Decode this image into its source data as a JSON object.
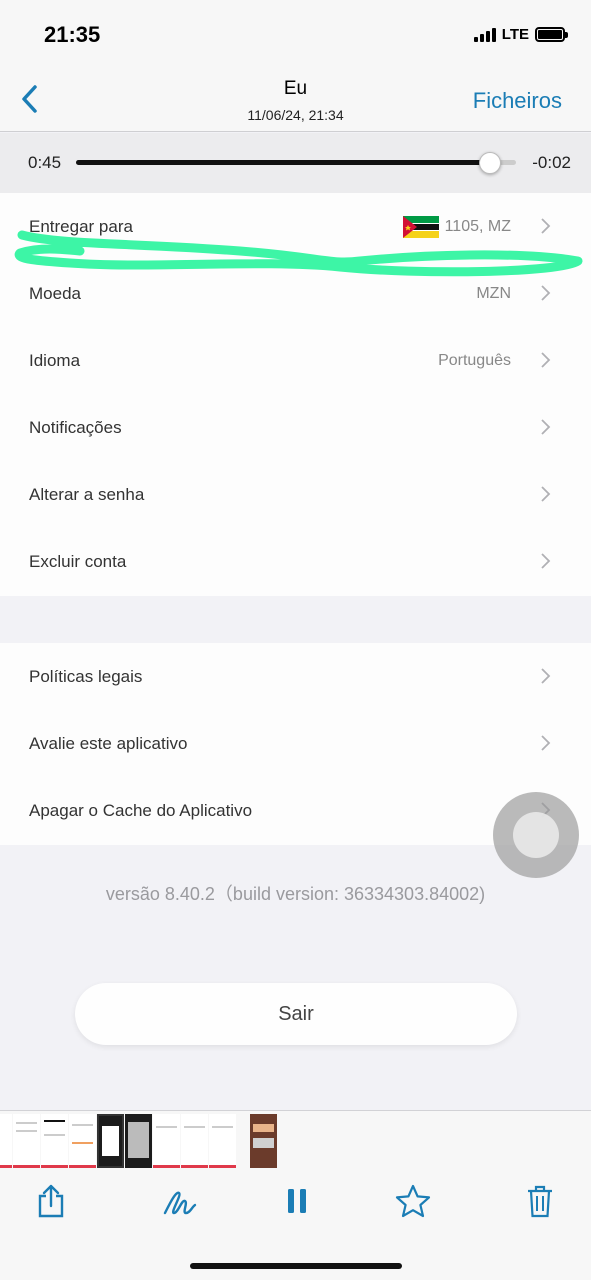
{
  "status_bar": {
    "time": "21:35",
    "network": "LTE",
    "icons": [
      "signal-icon",
      "battery-icon"
    ]
  },
  "nav": {
    "title": "Eu",
    "subtitle": "11/06/24, 21:34",
    "right_label": "Ficheiros",
    "accent_color": "#1b7db5"
  },
  "player": {
    "elapsed": "0:45",
    "remaining": "-0:02",
    "progress_fraction": 0.94
  },
  "settings": {
    "group1": [
      {
        "label": "Entregar para",
        "value": "1105, MZ",
        "icon": "mozambique-flag-icon"
      },
      {
        "label": "Moeda",
        "value": "MZN"
      },
      {
        "label": "Idioma",
        "value": "Português"
      },
      {
        "label": "Notificações",
        "value": ""
      },
      {
        "label": "Alterar a senha",
        "value": ""
      },
      {
        "label": "Excluir conta",
        "value": ""
      }
    ],
    "group2": [
      {
        "label": "Políticas legais"
      },
      {
        "label": "Avalie este aplicativo"
      },
      {
        "label": "Apagar o Cache do Aplicativo"
      }
    ]
  },
  "version_text": "versão 8.40.2（build version: 36334303.84002)",
  "logout_label": "Sair",
  "markup_color": "#3df5a6",
  "toolbar": {
    "icons": [
      "share-icon",
      "markup-icon",
      "pause-icon",
      "favorite-icon",
      "trash-icon"
    ],
    "icon_color": "#1b7db5"
  }
}
